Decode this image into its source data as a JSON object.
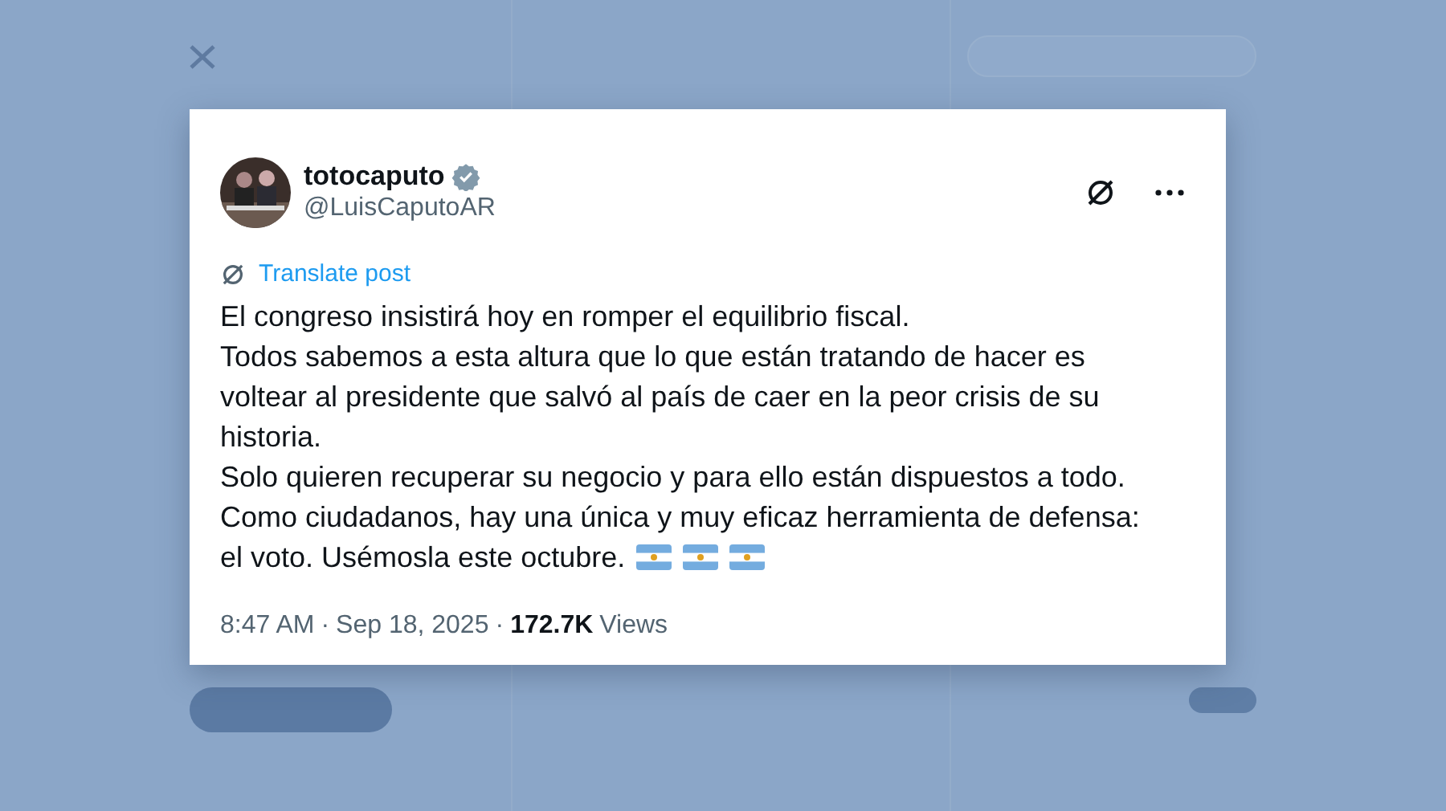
{
  "post": {
    "author": {
      "display_name": "totocaputo",
      "handle": "@LuisCaputoAR",
      "verified": true
    },
    "translate_link": "Translate post",
    "paragraphs": [
      {
        "text": "El congreso insistirá hoy en romper el equilibrio fiscal."
      },
      {
        "text": "Todos sabemos a esta altura que lo que están tratando de hacer es voltear al presidente que salvó al país de caer en la peor crisis de su historia."
      },
      {
        "text": "Solo quieren recuperar su negocio y para ello están dispuestos a todo."
      },
      {
        "text": "Como ciudadanos, hay una única y muy eficaz herramienta de defensa:"
      },
      {
        "text": "el voto. Usémosla este octubre.",
        "trailing_icons": [
          {
            "kind": "flag"
          },
          {
            "kind": "flag"
          },
          {
            "kind": "flag"
          }
        ]
      }
    ],
    "time": "8:47 AM",
    "separator_1": "·",
    "date": "Sep 18, 2025",
    "separator_2": "·",
    "views_count": "172.7K",
    "views_label": "Views"
  }
}
